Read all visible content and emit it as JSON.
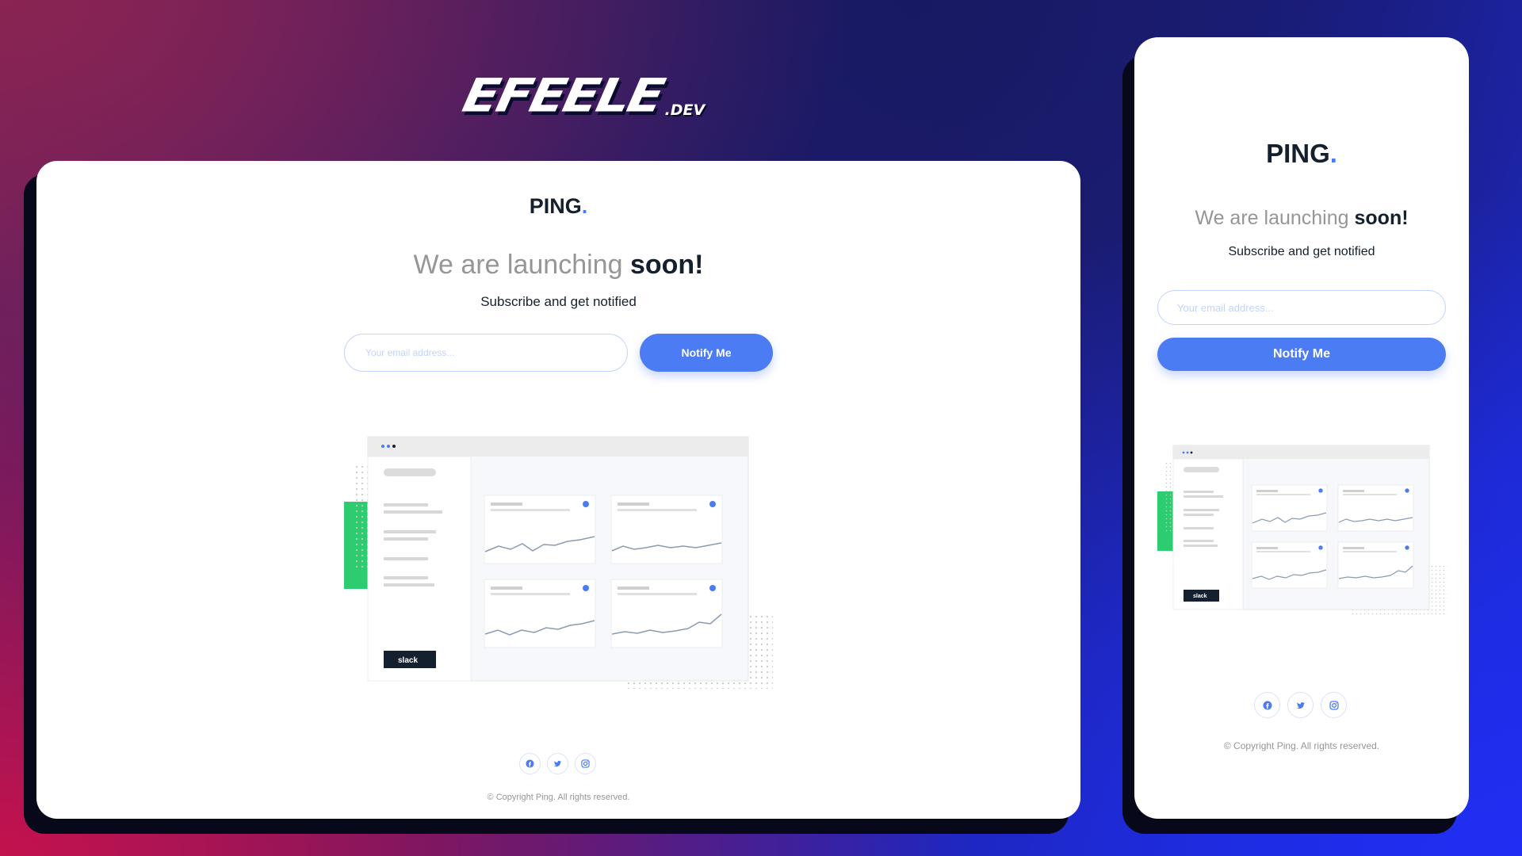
{
  "brand": {
    "name": "EFEELE",
    "suffix": ".DEV"
  },
  "desktop": {
    "logo_text": "PING",
    "logo_dot": ".",
    "headline_light": "We are launching ",
    "headline_bold": "soon!",
    "subtitle": "Subscribe and get notified",
    "email_placeholder": "Your email address...",
    "button_label": "Notify Me",
    "slack_label": "slack",
    "social": [
      "facebook-icon",
      "twitter-icon",
      "instagram-icon"
    ],
    "copyright": "© Copyright Ping. All rights reserved."
  },
  "mobile": {
    "logo_text": "PING",
    "logo_dot": ".",
    "headline_light": "We are launching ",
    "headline_bold": "soon!",
    "subtitle": "Subscribe and get notified",
    "email_placeholder": "Your email address...",
    "button_label": "Notify Me",
    "slack_label": "slack",
    "social": [
      "facebook-icon",
      "twitter-icon",
      "instagram-icon"
    ],
    "copyright": "© Copyright Ping. All rights reserved."
  },
  "colors": {
    "accent": "#4c7cf3",
    "dark": "#15202e",
    "gray": "#969696",
    "pale_blue": "#c2d3ff",
    "green": "#2ecc71"
  }
}
